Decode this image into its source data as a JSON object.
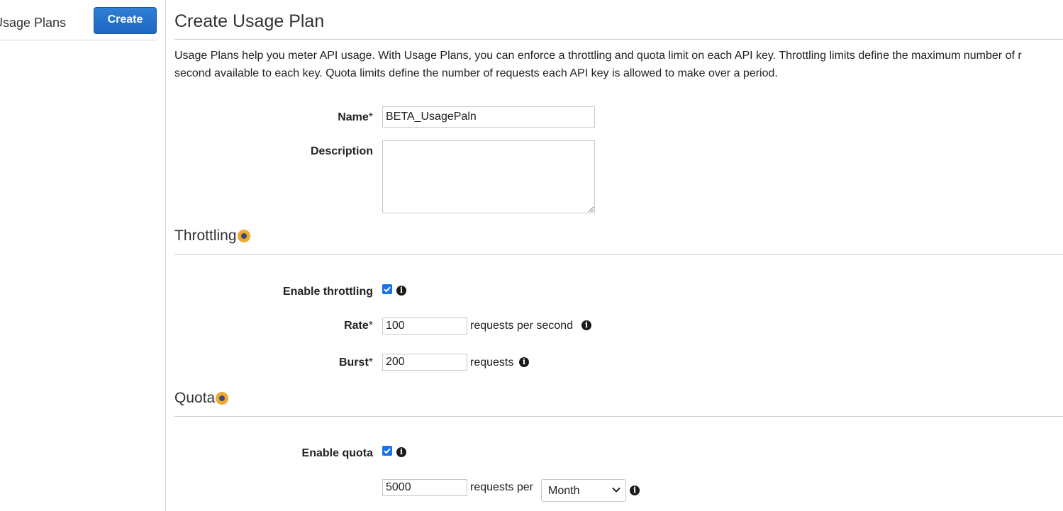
{
  "sidebar": {
    "title": "Usage Plans",
    "create_label": "Create"
  },
  "main": {
    "title": "Create Usage Plan",
    "intro_line1": "Usage Plans help you meter API usage. With Usage Plans, you can enforce a throttling and quota limit on each API key. Throttling limits define the maximum number of r",
    "intro_line2": "second available to each key. Quota limits define the number of requests each API key is allowed to make over a period."
  },
  "form": {
    "name_label": "Name",
    "name_req": "*",
    "name_value": "BETA_UsagePaln",
    "description_label": "Description",
    "description_value": ""
  },
  "throttling": {
    "section_title": "Throttling",
    "enable_label": "Enable throttling",
    "enabled": true,
    "rate_label": "Rate",
    "rate_req": "*",
    "rate_value": "100",
    "rate_unit": "requests per second",
    "burst_label": "Burst",
    "burst_req": "*",
    "burst_value": "200",
    "burst_unit": "requests"
  },
  "quota": {
    "section_title": "Quota",
    "enable_label": "Enable quota",
    "enabled": true,
    "limit_value": "5000",
    "limit_unit": "requests per",
    "period_value": "Month"
  },
  "colors": {
    "primary_button": "#1d67c0",
    "checkbox": "#1a73e8",
    "help_dot": "#f0a830"
  },
  "icons": {
    "info": "info-icon",
    "help": "help-dot-icon",
    "check": "checkmark-icon",
    "chevron": "chevron-down-icon"
  }
}
